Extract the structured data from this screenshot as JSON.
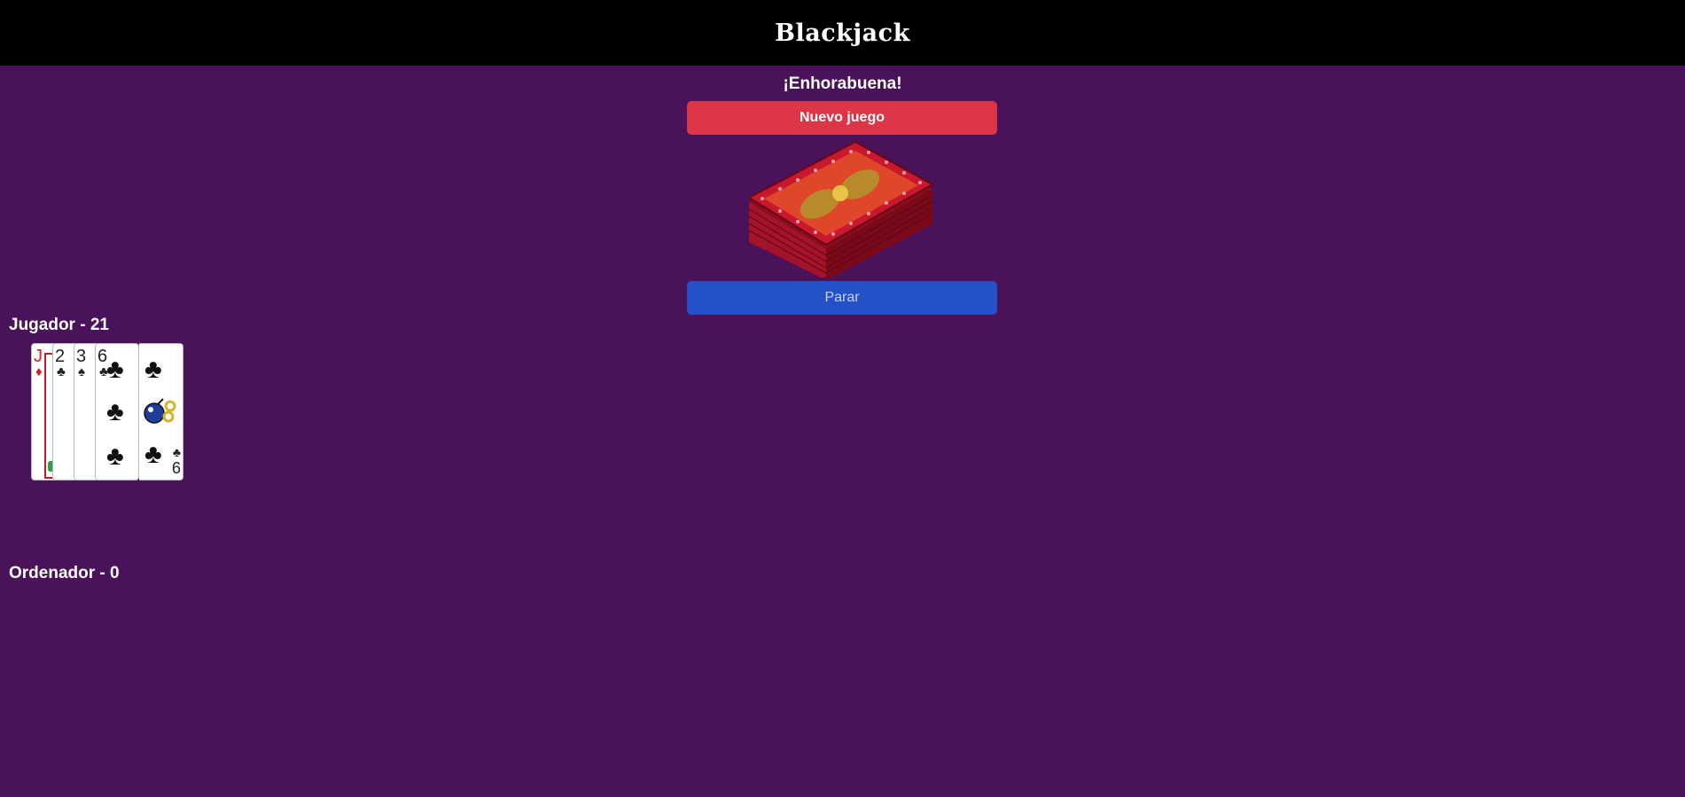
{
  "header": {
    "title": "Blackjack"
  },
  "status": {
    "message": "¡Enhorabuena!"
  },
  "buttons": {
    "new_game": "Nuevo juego",
    "stand": "Parar"
  },
  "player": {
    "label": "Jugador - 21",
    "cards": [
      {
        "rank": "J",
        "suit": "♦",
        "color": "red"
      },
      {
        "rank": "2",
        "suit": "♣",
        "color": "black"
      },
      {
        "rank": "3",
        "suit": "♠",
        "color": "black"
      },
      {
        "rank": "6",
        "suit": "♣",
        "color": "black"
      },
      {
        "rank": "9",
        "suit": "♣",
        "color": "black"
      }
    ]
  },
  "computer": {
    "label": "Ordenador - 0",
    "cards": []
  },
  "colors": {
    "background": "#4a1259",
    "header": "#000000",
    "new_game": "#dc3545",
    "stand": "#2450c8"
  }
}
